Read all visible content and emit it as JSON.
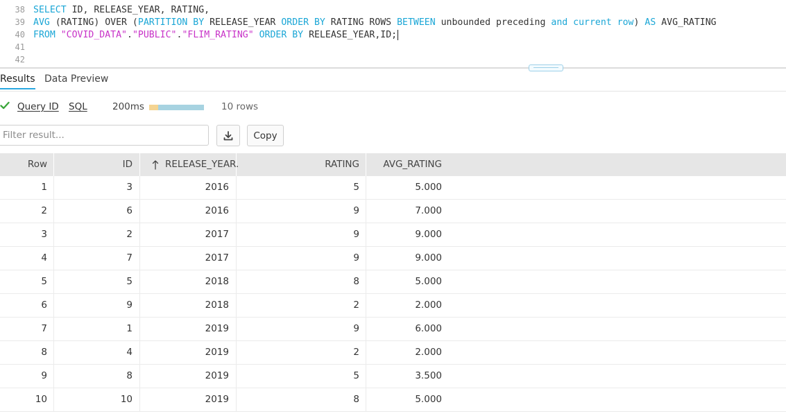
{
  "editor": {
    "lines": [
      {
        "num": "38",
        "tokens": [
          {
            "t": "SELECT",
            "c": "kw"
          },
          {
            "t": " ID, RELEASE_YEAR, RATING,",
            "c": "txt"
          }
        ]
      },
      {
        "num": "39",
        "tokens": [
          {
            "t": "AVG",
            "c": "kw"
          },
          {
            "t": " (RATING) OVER (",
            "c": "txt"
          },
          {
            "t": "PARTITION BY",
            "c": "kw"
          },
          {
            "t": " RELEASE_YEAR ",
            "c": "txt"
          },
          {
            "t": "ORDER BY",
            "c": "kw"
          },
          {
            "t": " RATING ROWS ",
            "c": "txt"
          },
          {
            "t": "BETWEEN",
            "c": "kw"
          },
          {
            "t": " unbounded preceding ",
            "c": "txt"
          },
          {
            "t": "and",
            "c": "kw"
          },
          {
            "t": " ",
            "c": "txt"
          },
          {
            "t": "current row",
            "c": "kw"
          },
          {
            "t": ") ",
            "c": "txt"
          },
          {
            "t": "AS",
            "c": "kw"
          },
          {
            "t": " AVG_RATING",
            "c": "txt"
          }
        ]
      },
      {
        "num": "40",
        "tokens": [
          {
            "t": "FROM",
            "c": "kw"
          },
          {
            "t": " ",
            "c": "txt"
          },
          {
            "t": "\"COVID_DATA\"",
            "c": "str"
          },
          {
            "t": ".",
            "c": "txt"
          },
          {
            "t": "\"PUBLIC\"",
            "c": "str"
          },
          {
            "t": ".",
            "c": "txt"
          },
          {
            "t": "\"FLIM_RATING\"",
            "c": "str"
          },
          {
            "t": " ",
            "c": "txt"
          },
          {
            "t": "ORDER BY",
            "c": "kw"
          },
          {
            "t": " RELEASE_YEAR,ID;",
            "c": "txt"
          }
        ]
      },
      {
        "num": "41",
        "tokens": []
      },
      {
        "num": "42",
        "tokens": []
      }
    ]
  },
  "tabs": {
    "results": "Results",
    "data_preview": "Data Preview"
  },
  "status": {
    "query_id": "Query ID",
    "sql": "SQL",
    "duration": "200ms",
    "rows": "10 rows",
    "progress_fraction": 0.16,
    "progress_color": "#f4d492",
    "bar_color": "#a7d3e1"
  },
  "filter": {
    "placeholder": "Filter result..."
  },
  "buttons": {
    "copy": "Copy"
  },
  "table": {
    "headers": {
      "row": "Row",
      "id": "ID",
      "release_year": "RELEASE_YEAR.",
      "rating": "RATING",
      "avg_rating": "AVG_RATING"
    },
    "rows": [
      {
        "row": "1",
        "id": "3",
        "year": "2016",
        "rating": "5",
        "avg": "5.000"
      },
      {
        "row": "2",
        "id": "6",
        "year": "2016",
        "rating": "9",
        "avg": "7.000"
      },
      {
        "row": "3",
        "id": "2",
        "year": "2017",
        "rating": "9",
        "avg": "9.000"
      },
      {
        "row": "4",
        "id": "7",
        "year": "2017",
        "rating": "9",
        "avg": "9.000"
      },
      {
        "row": "5",
        "id": "5",
        "year": "2018",
        "rating": "8",
        "avg": "5.000"
      },
      {
        "row": "6",
        "id": "9",
        "year": "2018",
        "rating": "2",
        "avg": "2.000"
      },
      {
        "row": "7",
        "id": "1",
        "year": "2019",
        "rating": "9",
        "avg": "6.000"
      },
      {
        "row": "8",
        "id": "4",
        "year": "2019",
        "rating": "2",
        "avg": "2.000"
      },
      {
        "row": "9",
        "id": "8",
        "year": "2019",
        "rating": "5",
        "avg": "3.500"
      },
      {
        "row": "10",
        "id": "10",
        "year": "2019",
        "rating": "8",
        "avg": "5.000"
      }
    ]
  },
  "colors": {
    "keyword": "#1aa6d6",
    "string": "#c832c8",
    "success": "#3aa63a",
    "tab_accent": "#29a8e0"
  }
}
